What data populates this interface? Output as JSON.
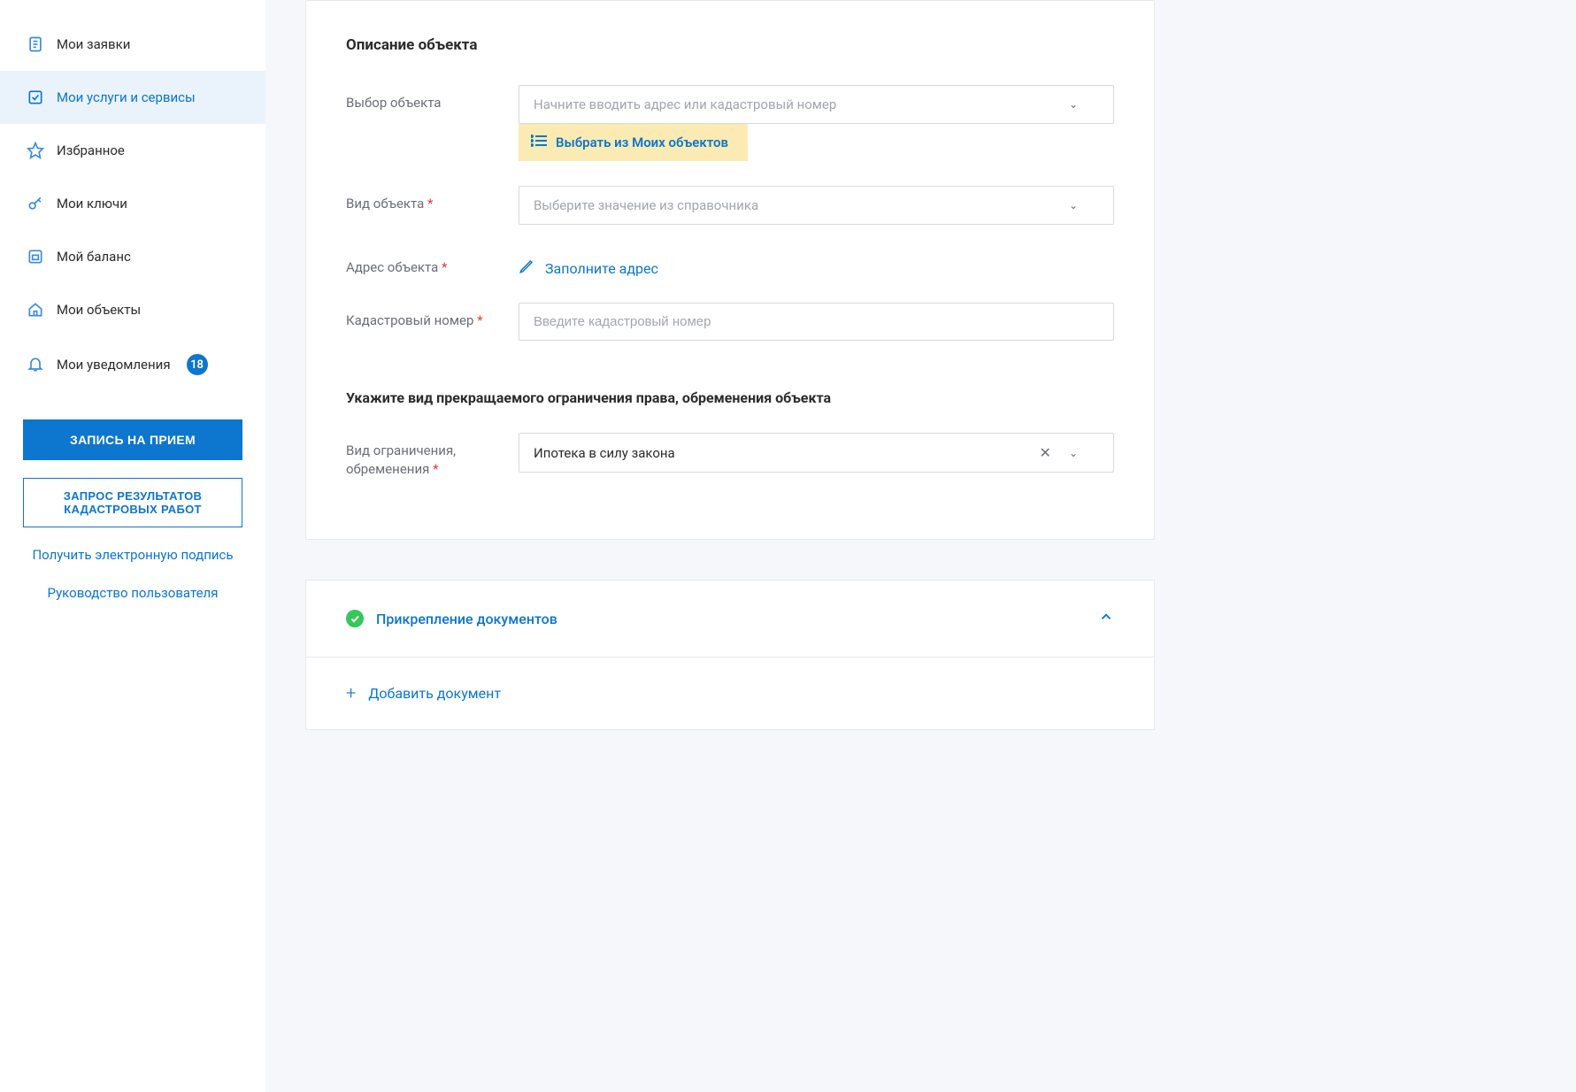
{
  "sidebar": {
    "items": [
      {
        "label": "Мои заявки",
        "icon": "document-icon"
      },
      {
        "label": "Мои услуги и сервисы",
        "icon": "check-square-icon"
      },
      {
        "label": "Избранное",
        "icon": "star-icon"
      },
      {
        "label": "Мои ключи",
        "icon": "key-icon"
      },
      {
        "label": "Мой баланс",
        "icon": "balance-icon"
      },
      {
        "label": "Мои объекты",
        "icon": "house-icon"
      },
      {
        "label": "Мои уведомления",
        "icon": "bell-icon"
      }
    ],
    "notifications_badge": "18",
    "btn_primary": "ЗАПИСЬ НА ПРИЕМ",
    "btn_outline": "ЗАПРОС РЕЗУЛЬТАТОВ КАДАСТРОВЫХ РАБОТ",
    "link_signature": "Получить электронную подпись",
    "link_guide": "Руководство пользователя"
  },
  "main": {
    "section1_title": "Описание объекта",
    "labels": {
      "select_object": "Выбор объекта",
      "object_type": "Вид объекта",
      "object_address": "Адрес объекта",
      "cadastral_number": "Кадастровый номер",
      "restriction_type": "Вид ограничения, обременения"
    },
    "placeholders": {
      "select_object": "Начните вводить адрес или кадастровый номер",
      "object_type": "Выберите значение из справочника",
      "cadastral_number": "Введите кадастровый номер"
    },
    "pick_from_my_objects": "Выбрать из Моих объектов",
    "fill_address": "Заполните адрес",
    "section2_title": "Укажите вид прекращаемого ограничения права, обременения объекта",
    "restriction_value": "Ипотека в силу закона",
    "attachments_title": "Прикрепление документов",
    "add_document": "Добавить документ"
  }
}
